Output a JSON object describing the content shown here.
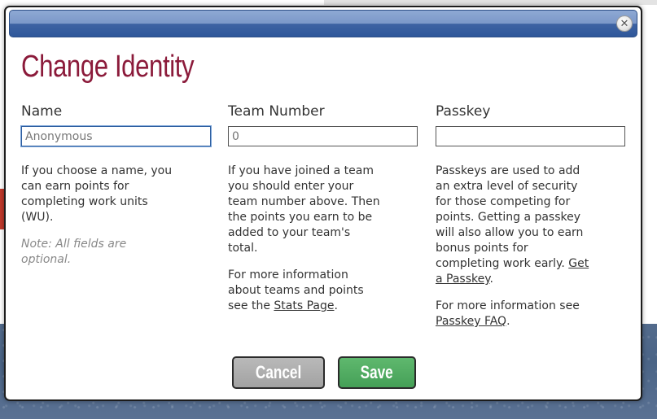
{
  "dialog": {
    "title": "Change Identity",
    "close_glyph": "✕",
    "close_icon": "close-icon"
  },
  "name": {
    "label": "Name",
    "value": "Anonymous",
    "placeholder": "",
    "help": "If you choose a name, you can earn points for completing work units (WU).",
    "note": "Note: All fields are optional."
  },
  "team": {
    "label": "Team Number",
    "value": "",
    "placeholder": "0",
    "help": "If you have joined a team you should enter your team number above. Then the points you earn to be added to your team's total.",
    "more_prefix": "For more information about teams and points see the ",
    "more_link": "Stats Page",
    "more_suffix": "."
  },
  "passkey": {
    "label": "Passkey",
    "value": "",
    "placeholder": "",
    "help": "Passkeys are used to add an extra level of security for those competing for points. Getting a passkey will also allow you to earn bonus points for completing work early.",
    "get_link": "Get a Passkey",
    "get_suffix": ".",
    "more_prefix": "For more information see ",
    "more_link": "Passkey FAQ",
    "more_suffix": "."
  },
  "buttons": {
    "cancel": "Cancel",
    "save": "Save"
  },
  "colors": {
    "title": "#8b1a3a",
    "titlebar": "#3e63a3",
    "save": "#45a057",
    "cancel": "#a2a2a2"
  }
}
